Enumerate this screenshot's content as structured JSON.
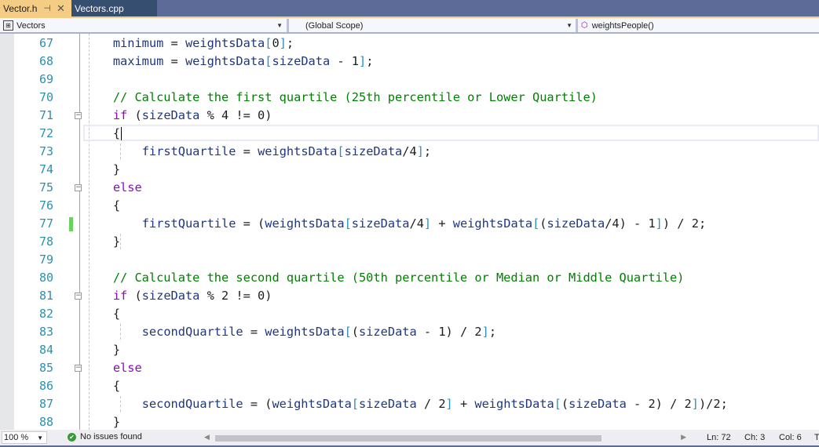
{
  "tabs": [
    {
      "label": "Vector.h",
      "active": true,
      "pin_icon": "pin-icon",
      "close_icon": "close-icon"
    },
    {
      "label": "Vectors.cpp",
      "active": false
    }
  ],
  "navbar": {
    "project": "Vectors",
    "scope": "(Global Scope)",
    "member": "weightsPeople()"
  },
  "editor": {
    "current_line": 72,
    "changed_lines": [
      77
    ],
    "lines": [
      {
        "n": "67",
        "html": "    <span class='id'>minimum</span> = <span class='id'>weightsData</span><span class='br'>[</span>0<span class='br'>]</span>;"
      },
      {
        "n": "68",
        "html": "    <span class='id'>maximum</span> = <span class='id'>weightsData</span><span class='br'>[</span><span class='id'>sizeData</span> - 1<span class='br'>]</span>;"
      },
      {
        "n": "69",
        "html": ""
      },
      {
        "n": "70",
        "html": "    <span class='cm'>// Calculate the first quartile (25th percentile or Lower Quartile)</span>"
      },
      {
        "n": "71",
        "html": "    <span class='kw'>if</span> (<span class='id'>sizeData</span> % 4 != 0)",
        "fold": true
      },
      {
        "n": "72",
        "html": "    {<span class='caret'></span>",
        "current": true
      },
      {
        "n": "73",
        "html": "        <span class='id'>firstQuartile</span> = <span class='id'>weightsData</span><span class='br'>[</span><span class='id'>sizeData</span>/4<span class='br'>]</span>;"
      },
      {
        "n": "74",
        "html": "    }"
      },
      {
        "n": "75",
        "html": "    <span class='kw'>else</span>",
        "fold": true
      },
      {
        "n": "76",
        "html": "    {"
      },
      {
        "n": "77",
        "html": "        <span class='id'>firstQuartile</span> = (<span class='id'>weightsData</span><span class='br'>[</span><span class='id'>sizeData</span>/4<span class='br'>]</span> + <span class='id'>weightsData</span><span class='br'>[</span>(<span class='id'>sizeData</span>/4) - 1<span class='br'>]</span>) / 2;",
        "changed": true
      },
      {
        "n": "78",
        "html": "    }"
      },
      {
        "n": "79",
        "html": ""
      },
      {
        "n": "80",
        "html": "    <span class='cm'>// Calculate the second quartile (50th percentile or Median or Middle Quartile)</span>"
      },
      {
        "n": "81",
        "html": "    <span class='kw'>if</span> (<span class='id'>sizeData</span> % 2 != 0)",
        "fold": true
      },
      {
        "n": "82",
        "html": "    {"
      },
      {
        "n": "83",
        "html": "        <span class='id'>secondQuartile</span> = <span class='id'>weightsData</span><span class='br'>[</span>(<span class='id'>sizeData</span> - 1) / 2<span class='br'>]</span>;"
      },
      {
        "n": "84",
        "html": "    }"
      },
      {
        "n": "85",
        "html": "    <span class='kw'>else</span>",
        "fold": true
      },
      {
        "n": "86",
        "html": "    {"
      },
      {
        "n": "87",
        "html": "        <span class='id'>secondQuartile</span> = (<span class='id'>weightsData</span><span class='br'>[</span><span class='id'>sizeData</span> / 2<span class='br'>]</span> + <span class='id'>weightsData</span><span class='br'>[</span>(<span class='id'>sizeData</span> - 2) / 2<span class='br'>]</span>)/2;"
      },
      {
        "n": "88",
        "html": "    }"
      }
    ]
  },
  "status": {
    "zoom": "100 %",
    "issues": "No issues found",
    "ln": "Ln: 72",
    "ch": "Ch: 3",
    "col": "Col: 6",
    "extra": "T"
  },
  "colors": {
    "line_number": "#2b91af",
    "keyword": "#8f08c4",
    "comment": "#008000",
    "change_bar": "#6ad35f",
    "active_tab": "#f5cc84"
  }
}
